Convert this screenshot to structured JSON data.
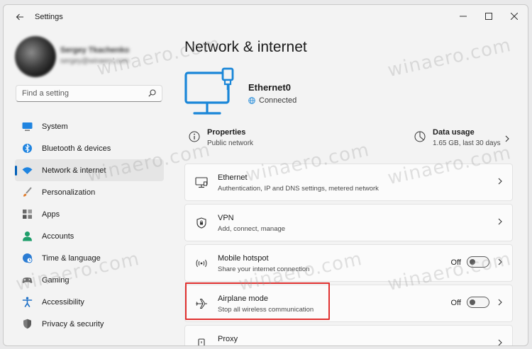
{
  "window": {
    "title": "Settings"
  },
  "search": {
    "placeholder": "Find a setting"
  },
  "profile": {
    "name": "Sergey Tkachenko",
    "email": "sergey@winaero.com"
  },
  "nav": [
    {
      "label": "System",
      "icon": "monitor-icon",
      "color": "#0067c0"
    },
    {
      "label": "Bluetooth & devices",
      "icon": "bluetooth-icon",
      "color": "#0067c0"
    },
    {
      "label": "Network & internet",
      "icon": "wifi-icon",
      "color": "#0067c0",
      "active": true
    },
    {
      "label": "Personalization",
      "icon": "brush-icon",
      "color": "#e07b2a"
    },
    {
      "label": "Apps",
      "icon": "apps-icon",
      "color": "#5a5a5a"
    },
    {
      "label": "Accounts",
      "icon": "person-icon",
      "color": "#1f9e6b"
    },
    {
      "label": "Time & language",
      "icon": "globe-clock-icon",
      "color": "#2b7cd3"
    },
    {
      "label": "Gaming",
      "icon": "gamepad-icon",
      "color": "#6a6a6a"
    },
    {
      "label": "Accessibility",
      "icon": "accessibility-icon",
      "color": "#1d6fc6"
    },
    {
      "label": "Privacy & security",
      "icon": "shield-icon",
      "color": "#6b6b6b"
    }
  ],
  "main": {
    "title": "Network & internet",
    "adapter": {
      "name": "Ethernet0",
      "status": "Connected"
    },
    "properties": {
      "title": "Properties",
      "subtitle": "Public network"
    },
    "data_usage": {
      "title": "Data usage",
      "subtitle": "1.65 GB, last 30 days"
    },
    "cards": [
      {
        "title": "Ethernet",
        "subtitle": "Authentication, IP and DNS settings, metered network",
        "icon": "ethernet-icon"
      },
      {
        "title": "VPN",
        "subtitle": "Add, connect, manage",
        "icon": "vpn-shield-icon"
      },
      {
        "title": "Mobile hotspot",
        "subtitle": "Share your internet connection",
        "icon": "hotspot-icon",
        "toggle": "Off"
      },
      {
        "title": "Airplane mode",
        "subtitle": "Stop all wireless communication",
        "icon": "airplane-icon",
        "toggle": "Off"
      },
      {
        "title": "Proxy",
        "subtitle": "",
        "icon": "proxy-icon"
      }
    ]
  },
  "watermark": "winaero.com",
  "colors": {
    "accent": "#005fb8",
    "highlight": "#e0302f"
  }
}
